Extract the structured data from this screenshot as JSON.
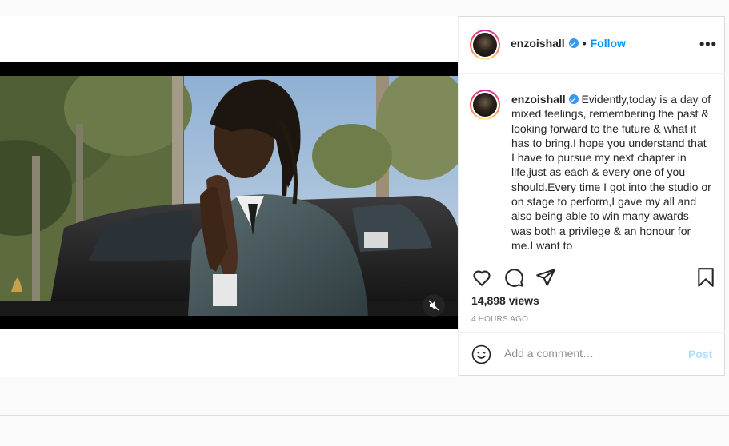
{
  "post": {
    "username": "enzoishall",
    "verified": true,
    "follow_label": "Follow",
    "separator": "•",
    "more_label": "•••",
    "caption_text": "Evidently,today is a day of mixed feelings, remembering the past & looking forward to the future & what it has to bring.I hope you understand that I have to pursue my next chapter in life,just as each & every one of you should.Every time I got into the studio or on stage to perform,I gave my all and also being able to win many awards was both a privilege & an honour for me.I want to",
    "views": "14,898 views",
    "time_ago": "4 HOURS AGO",
    "comment_placeholder": "Add a comment…",
    "post_label": "Post"
  },
  "video": {
    "muted": true
  },
  "colors": {
    "accent": "#0095f6",
    "verified": "#3897f0",
    "post_disabled": "#b2dffc",
    "muted_text": "#8e8e8e"
  },
  "icons": [
    "heart-icon",
    "comment-icon",
    "share-icon",
    "bookmark-icon",
    "emoji-icon",
    "mute-icon",
    "verified-icon",
    "more-icon"
  ]
}
